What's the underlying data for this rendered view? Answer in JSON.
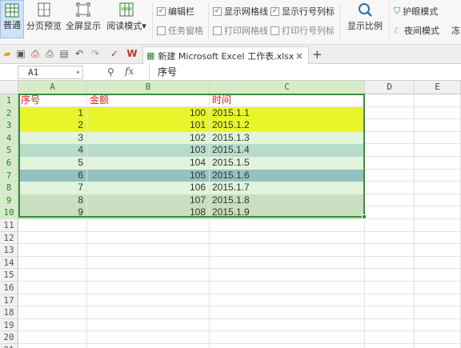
{
  "ribbon": {
    "buttons": [
      {
        "label": "普通",
        "icon": "normal-view-icon",
        "active": true
      },
      {
        "label": "分页预览",
        "icon": "page-break-preview-icon"
      },
      {
        "label": "全屏显示",
        "icon": "full-screen-icon"
      },
      {
        "label": "阅读模式",
        "icon": "reading-mode-icon",
        "dropdown": "▾"
      }
    ],
    "checks": [
      {
        "label": "编辑栏",
        "checked": true
      },
      {
        "label": "任务窗格",
        "checked": false
      },
      {
        "label": "显示网格线",
        "checked": true
      },
      {
        "label": "打印网格线",
        "checked": false
      },
      {
        "label": "显示行号列标",
        "checked": true
      },
      {
        "label": "打印行号列标",
        "checked": false
      }
    ],
    "display_ratio": "显示比例",
    "eye_mode": "护眼模式",
    "night_mode": "夜间模式",
    "cutoff": "冻"
  },
  "tabbar": {
    "doc_tab_label": "新建 Microsoft Excel 工作表.xlsx",
    "close": "×",
    "new_tab": "+"
  },
  "formula_bar": {
    "name_box": "A1",
    "fx": "fx",
    "content": "序号"
  },
  "columns": [
    "A",
    "B",
    "C",
    "D",
    "E"
  ],
  "row_numbers": [
    "1",
    "2",
    "3",
    "4",
    "5",
    "6",
    "7",
    "8",
    "9",
    "10",
    "11",
    "12",
    "13",
    "14",
    "15",
    "16",
    "17",
    "18",
    "19",
    "20",
    "21"
  ],
  "table": {
    "headers": [
      "序号",
      "金额",
      "时间"
    ],
    "rows": [
      {
        "seq": "1",
        "amount": "100",
        "time": "2015.1.1",
        "fill": "#e8f52a"
      },
      {
        "seq": "2",
        "amount": "101",
        "time": "2015.1.2",
        "fill": "#e8f52a"
      },
      {
        "seq": "3",
        "amount": "102",
        "time": "2015.1.3",
        "fill": "#e2f4dc"
      },
      {
        "seq": "4",
        "amount": "103",
        "time": "2015.1.4",
        "fill": "#b8dcca"
      },
      {
        "seq": "5",
        "amount": "104",
        "time": "2015.1.5",
        "fill": "#e2f4dc"
      },
      {
        "seq": "6",
        "amount": "105",
        "time": "2015.1.6",
        "fill": "#93c2c0"
      },
      {
        "seq": "7",
        "amount": "106",
        "time": "2015.1.7",
        "fill": "#e2f4dc"
      },
      {
        "seq": "8",
        "amount": "107",
        "time": "2015.1.8",
        "fill": "#c9dfc0"
      },
      {
        "seq": "9",
        "amount": "108",
        "time": "2015.1.9",
        "fill": "#c9dfc0"
      }
    ]
  },
  "colors": {
    "selection": "#3a8e3a",
    "header_text": "#d9261c"
  }
}
